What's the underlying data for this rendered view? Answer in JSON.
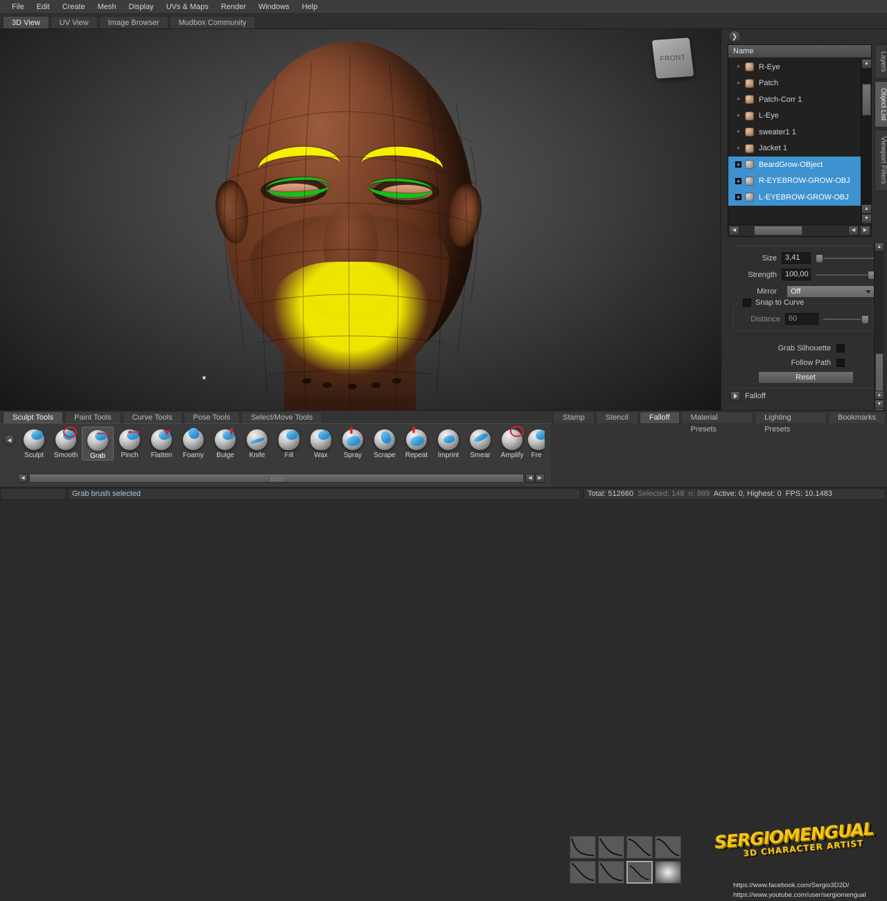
{
  "menu": {
    "items": [
      "File",
      "Edit",
      "Create",
      "Mesh",
      "Display",
      "UVs & Maps",
      "Render",
      "Windows",
      "Help"
    ]
  },
  "view_tabs": {
    "items": [
      "3D View",
      "UV View",
      "Image Browser",
      "Mudbox Community"
    ],
    "active": "3D View"
  },
  "viewport": {
    "view_cube_label": "FRONT"
  },
  "object_list": {
    "panel_collapse_icon": "chevron-right-icon",
    "column_header": "Name",
    "rows": [
      {
        "label": "R-Eye",
        "selected": false
      },
      {
        "label": "Patch",
        "selected": false
      },
      {
        "label": "Patch-Corr 1",
        "selected": false
      },
      {
        "label": "L-Eye",
        "selected": false
      },
      {
        "label": "sweater1 1",
        "selected": false
      },
      {
        "label": "Jacket 1",
        "selected": false
      },
      {
        "label": "BeardGrow-OBject",
        "selected": true
      },
      {
        "label": "R-EYEBROW-GROW-OBJ",
        "selected": true
      },
      {
        "label": "L-EYEBROW-GROW-OBJ",
        "selected": true
      }
    ],
    "selection_color": "#3e92cf"
  },
  "vertical_tabs": {
    "items": [
      "Layers",
      "Object List",
      "Viewport Filters"
    ],
    "active": "Object List"
  },
  "properties": {
    "size_label": "Size",
    "size_value": "3,41",
    "strength_label": "Strength",
    "strength_value": "100,00",
    "mirror_label": "Mirror",
    "mirror_value": "Off",
    "snap_to_curve_label": "Snap to Curve",
    "distance_label": "Distance",
    "distance_value": "60",
    "grab_silhouette_label": "Grab Silhouette",
    "follow_path_label": "Follow Path",
    "reset_label": "Reset",
    "falloff_section_label": "Falloff"
  },
  "tool_tabs": {
    "items": [
      "Sculpt Tools",
      "Paint Tools",
      "Curve Tools",
      "Pose Tools",
      "Select/Move Tools"
    ],
    "active": "Sculpt Tools"
  },
  "tools": {
    "items": [
      {
        "label": "Sculpt",
        "icon": "sculpt-brush-icon",
        "selected": false
      },
      {
        "label": "Smooth",
        "icon": "smooth-brush-icon",
        "selected": false
      },
      {
        "label": "Grab",
        "icon": "grab-brush-icon",
        "selected": true
      },
      {
        "label": "Pinch",
        "icon": "pinch-brush-icon",
        "selected": false
      },
      {
        "label": "Flatten",
        "icon": "flatten-brush-icon",
        "selected": false
      },
      {
        "label": "Foamy",
        "icon": "foamy-brush-icon",
        "selected": false
      },
      {
        "label": "Bulge",
        "icon": "bulge-brush-icon",
        "selected": false
      },
      {
        "label": "Knife",
        "icon": "knife-brush-icon",
        "selected": false
      },
      {
        "label": "Fill",
        "icon": "fill-brush-icon",
        "selected": false
      },
      {
        "label": "Wax",
        "icon": "wax-brush-icon",
        "selected": false
      },
      {
        "label": "Spray",
        "icon": "spray-brush-icon",
        "selected": false
      },
      {
        "label": "Scrape",
        "icon": "scrape-brush-icon",
        "selected": false
      },
      {
        "label": "Repeat",
        "icon": "repeat-brush-icon",
        "selected": false
      },
      {
        "label": "Imprint",
        "icon": "imprint-brush-icon",
        "selected": false
      },
      {
        "label": "Smear",
        "icon": "smear-brush-icon",
        "selected": false
      },
      {
        "label": "Amplify",
        "icon": "amplify-brush-icon",
        "selected": false
      },
      {
        "label": "Fre",
        "icon": "freeze-brush-icon",
        "selected": false
      }
    ]
  },
  "tray_tabs": {
    "items": [
      "Stamp",
      "Stencil",
      "Falloff",
      "Material Presets",
      "Lighting Presets",
      "Bookmarks"
    ],
    "active": "Falloff"
  },
  "falloff_presets": {
    "selected_index": 6,
    "count": 8
  },
  "watermark": {
    "name_part1": "SERGIO",
    "name_part2": "MENGUAL",
    "subtitle": "3D CHARACTER ARTIST",
    "facebook_url": "https://www.facebook.com/Sergio3D2D/",
    "youtube_url": "https://www.youtube.com/user/sergiomengual"
  },
  "status_bar": {
    "message": "Grab brush selected",
    "total_label": "Total:",
    "total_value": "512660",
    "selected_label": "Selected:",
    "selected_value": "148",
    "faces_tail": "n: 889",
    "active_text": "Active: 0, Highest: 0",
    "fps_text": "FPS: 10.1483"
  }
}
